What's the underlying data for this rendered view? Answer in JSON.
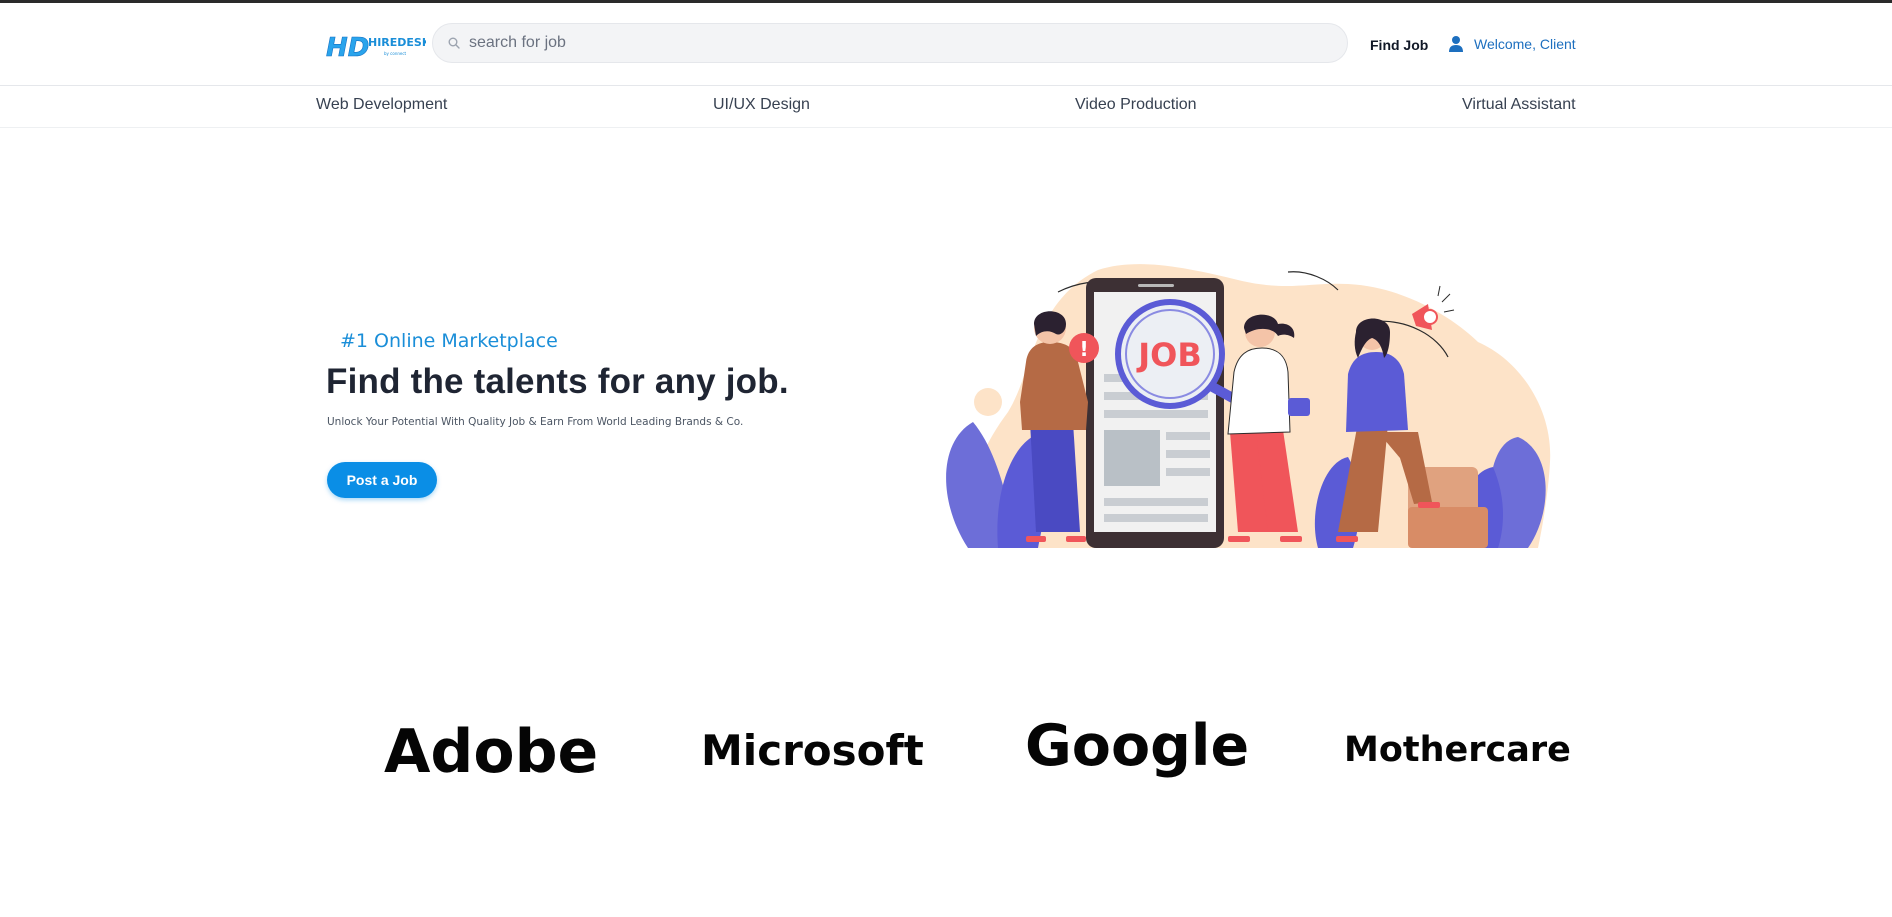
{
  "header": {
    "logo_text": "HD",
    "logo_brand": "HIREDESK",
    "logo_sub": "by connect",
    "search_placeholder": "search for job",
    "search_icon": "search-icon",
    "find_job_label": "Find Job",
    "user_icon": "user-icon",
    "welcome_label": "Welcome, Client"
  },
  "categories": [
    "Web Development",
    "UI/UX Design",
    "Video Production",
    "Virtual Assistant"
  ],
  "hero": {
    "tagline": "#1 Online Marketplace",
    "headline": "Find the talents for any job.",
    "subline": "Unlock Your Potential With Quality Job & Earn From World Leading Brands & Co.",
    "cta_label": "Post a Job",
    "illustration_sign": "JOB"
  },
  "brands": [
    "Adobe",
    "Microsoft",
    "Google",
    "Mothercare"
  ],
  "colors": {
    "accent": "#0a8ee6",
    "link_blue": "#1d6fbf",
    "headline": "#1f2533",
    "illus_peach": "#fde3c8",
    "illus_purple": "#5b5bd6",
    "illus_red": "#f0555a",
    "illus_brown": "#b56a45"
  }
}
